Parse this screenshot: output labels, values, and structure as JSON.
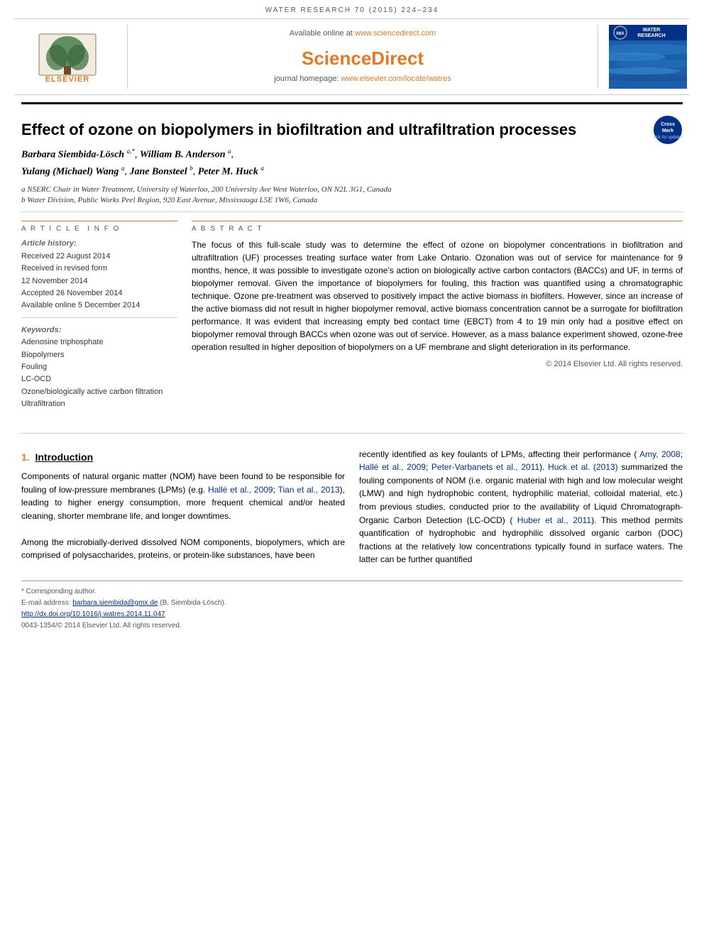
{
  "journal": {
    "name": "WATER RESEARCH 70 (2015) 224–234",
    "homepage_text": "journal homepage:",
    "homepage_url": "www.elsevier.com/locate/watres",
    "available_online_text": "Available online at",
    "sciencedirect_url": "www.sciencedirect.com",
    "sciencedirect_brand": "ScienceDirect"
  },
  "elsevier": {
    "brand_name": "ELSEVIER"
  },
  "water_research_logo": {
    "title": "WATER RESEARCH",
    "iwa_text": "IWA"
  },
  "article": {
    "title": "Effect of ozone on biopolymers in biofiltration and ultrafiltration processes",
    "authors": "Barbara Siembida-Lösch a,*, William B. Anderson a, Yulang (Michael) Wang a, Jane Bonsteel b, Peter M. Huck a",
    "affiliation_a": "a NSERC Chair in Water Treatment, University of Waterloo, 200 University Ave West Waterloo, ON N2L 3G1, Canada",
    "affiliation_b": "b Water Division, Public Works Peel Region, 920 East Avenue, Mississauga L5E 1W6, Canada",
    "article_history_label": "Article history:",
    "received_1": "Received 22 August 2014",
    "received_revised": "Received in revised form",
    "received_revised_date": "12 November 2014",
    "accepted": "Accepted 26 November 2014",
    "available_online": "Available online 5 December 2014",
    "keywords_label": "Keywords:",
    "keywords": [
      "Adenosine triphosphate",
      "Biopolymers",
      "Fouling",
      "LC-OCD",
      "Ozone/biologically active carbon filtration",
      "Ultrafiltration"
    ],
    "abstract_label": "ABSTRACT",
    "abstract": "The focus of this full-scale study was to determine the effect of ozone on biopolymer concentrations in biofiltration and ultrafiltration (UF) processes treating surface water from Lake Ontario. Ozonation was out of service for maintenance for 9 months, hence, it was possible to investigate ozone's action on biologically active carbon contactors (BACCs) and UF, in terms of biopolymer removal. Given the importance of biopolymers for fouling, this fraction was quantified using a chromatographic technique. Ozone pre-treatment was observed to positively impact the active biomass in biofilters. However, since an increase of the active biomass did not result in higher biopolymer removal, active biomass concentration cannot be a surrogate for biofiltration performance. It was evident that increasing empty bed contact time (EBCT) from 4 to 19 min only had a positive effect on biopolymer removal through BACCs when ozone was out of service. However, as a mass balance experiment showed, ozone-free operation resulted in higher deposition of biopolymers on a UF membrane and slight deterioration in its performance.",
    "copyright": "© 2014 Elsevier Ltd. All rights reserved."
  },
  "section1": {
    "number": "1.",
    "title": "Introduction",
    "paragraph1": "Components of natural organic matter (NOM) have been found to be responsible for fouling of low-pressure membranes (LPMs) (e.g. Hallé et al., 2009; Tian et al., 2013), leading to higher energy consumption, more frequent chemical and/or heated cleaning, shorter membrane life, and longer downtimes.",
    "paragraph2": "Among the microbially-derived dissolved NOM components, biopolymers, which are comprised of polysaccharides, proteins, or protein-like substances, have been"
  },
  "section1_right": {
    "paragraph1": "recently identified as key foulants of LPMs, affecting their performance (Amy, 2008; Hallé et al., 2009; Peter-Varbanets et al., 2011). Huck et al. (2013) summarized the fouling components of NOM (i.e. organic material with high and low molecular weight (LMW) and high hydrophobic content, hydrophilic material, colloidal material, etc.) from previous studies, conducted prior to the availability of Liquid Chromatograph-Organic Carbon Detection (LC-OCD) (Huber et al., 2011). This method permits quantification of hydrophobic and hydrophilic dissolved organic carbon (DOC) fractions at the relatively low concentrations typically found in surface waters. The latter can be further quantified"
  },
  "footer": {
    "corresponding_author": "* Corresponding author.",
    "email_label": "E-mail address:",
    "email": "barbara.siembida@gmx.de",
    "email_suffix": "(B. Siembida-Lösch).",
    "doi_url": "http://dx.doi.org/10.1016/j.watres.2014.11.047",
    "issn": "0043-1354/© 2014 Elsevier Ltd. All rights reserved."
  }
}
